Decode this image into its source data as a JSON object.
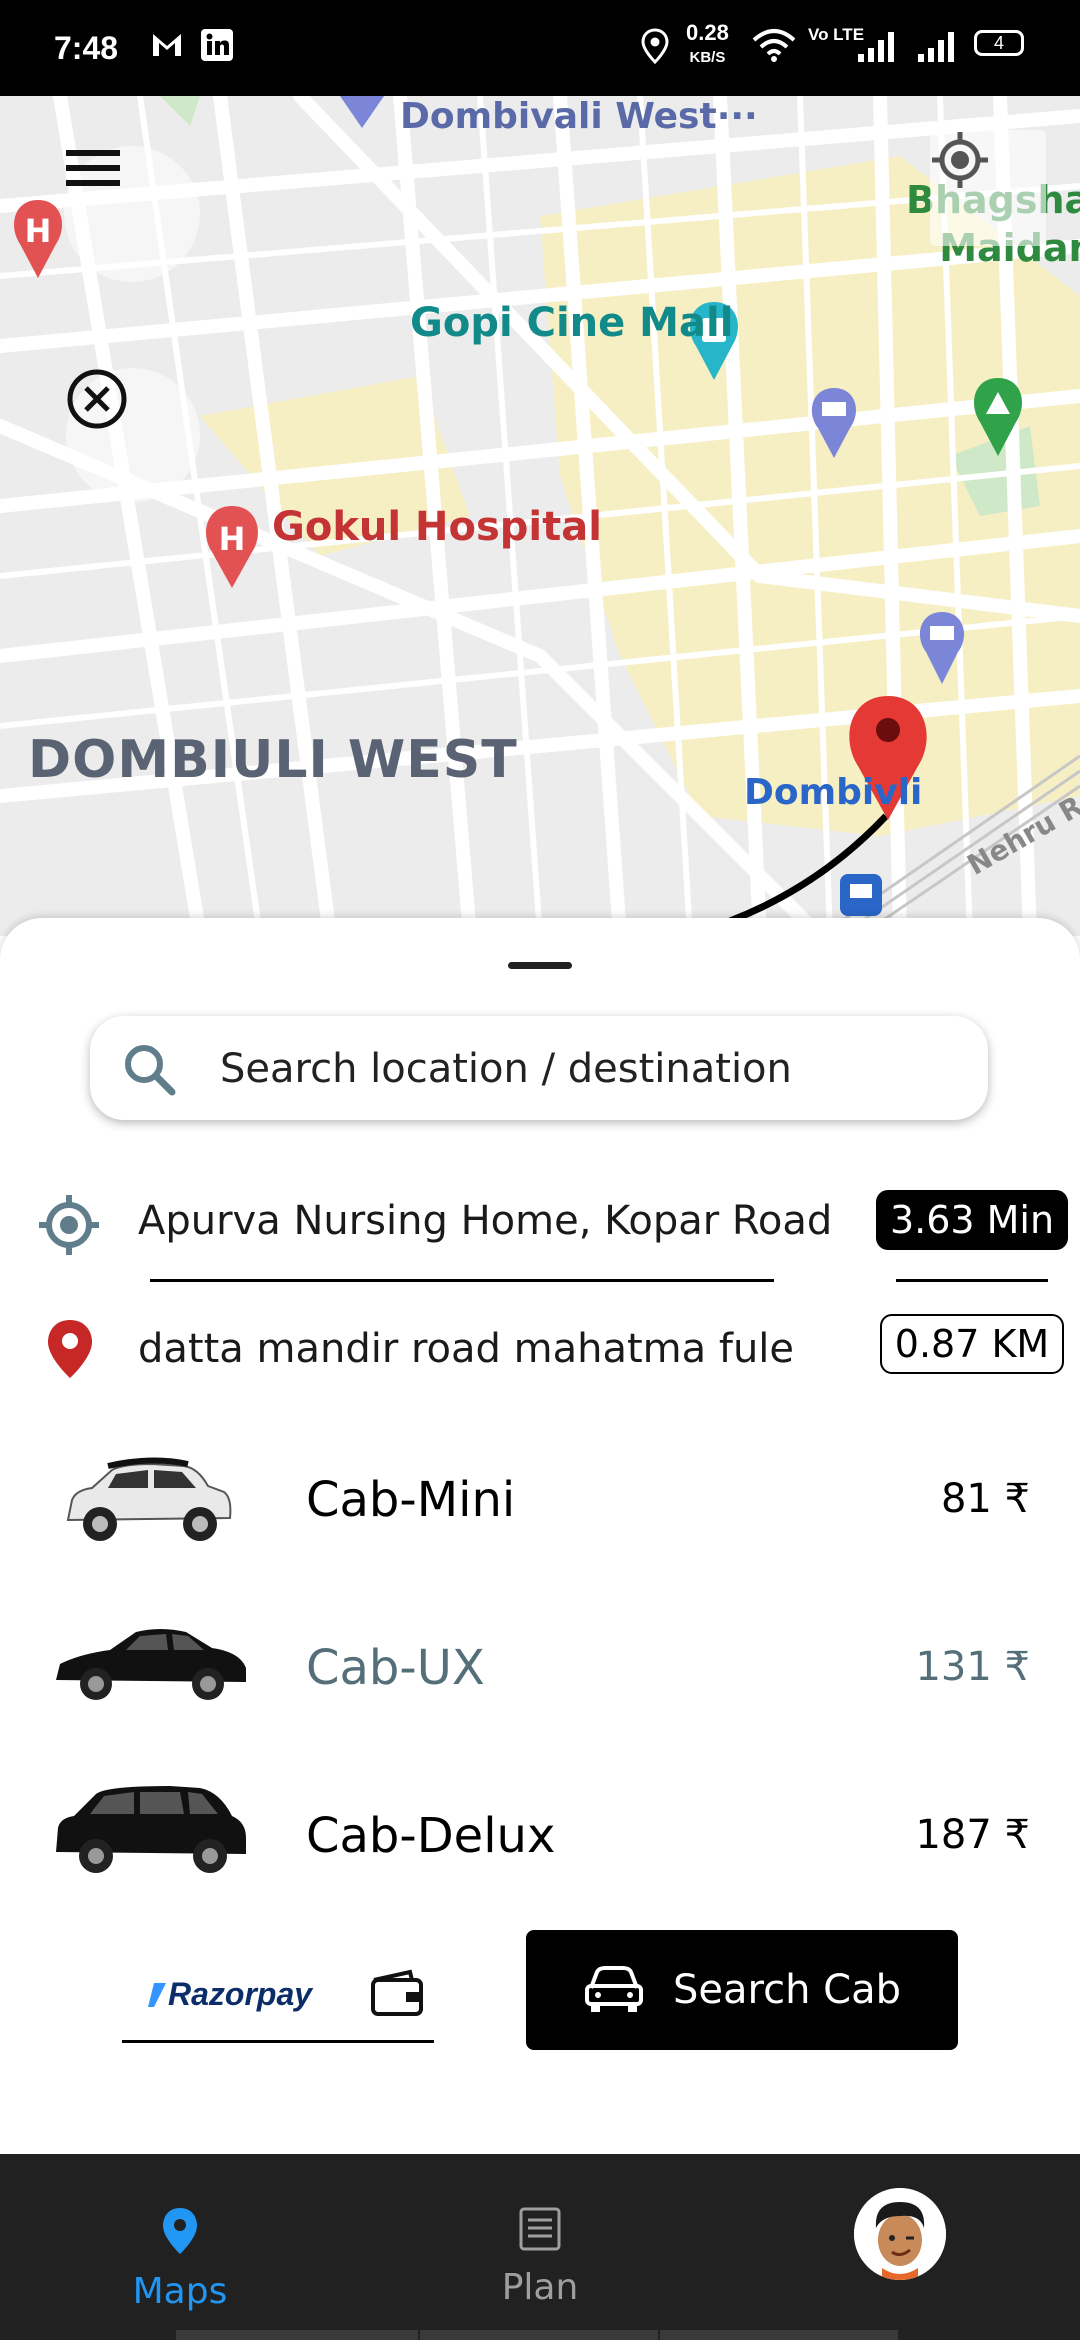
{
  "status_bar": {
    "time": "7:48",
    "net_speed_value": "0.28",
    "net_speed_unit": "KB/S",
    "volte": "Vo LTE",
    "battery": "4",
    "icons": [
      "gmail-icon",
      "linkedin-icon",
      "location-icon",
      "wifi-icon",
      "signal-icon",
      "battery-icon"
    ]
  },
  "map": {
    "labels": {
      "west_top": "Dombivali West···",
      "gopi": "Gopi Cine Mall",
      "gokul": "Gokul Hospital",
      "area": "DOMBIULI WEST",
      "station": "Dombivli",
      "maidan_1": "Bhagshala",
      "maidan_2": "Maidan",
      "road": "Nehru Rd"
    },
    "colors": {
      "background": "#ececec",
      "road": "#ffffff",
      "highlight": "#f7efc4",
      "pin": "#e53935"
    }
  },
  "search": {
    "placeholder": "Search location / destination",
    "value": ""
  },
  "pickup": {
    "text": "Apurva Nursing Home, Kopar Road",
    "eta": "3.63 Min"
  },
  "drop": {
    "text": "datta mandir road mahatma fule",
    "distance": "0.87 KM"
  },
  "cabs": [
    {
      "name": "Cab-Mini",
      "price": "81 ₹",
      "selected": false
    },
    {
      "name": "Cab-UX",
      "price": "131 ₹",
      "selected": true
    },
    {
      "name": "Cab-Delux",
      "price": "187 ₹",
      "selected": false
    }
  ],
  "payment": {
    "provider": "Razorpay"
  },
  "actions": {
    "search_cab": "Search Cab"
  },
  "nav": {
    "maps": "Maps",
    "plan": "Plan"
  },
  "colors": {
    "accent": "#2196f3",
    "selected_cab": "#546e7a",
    "navbar": "#212121"
  }
}
